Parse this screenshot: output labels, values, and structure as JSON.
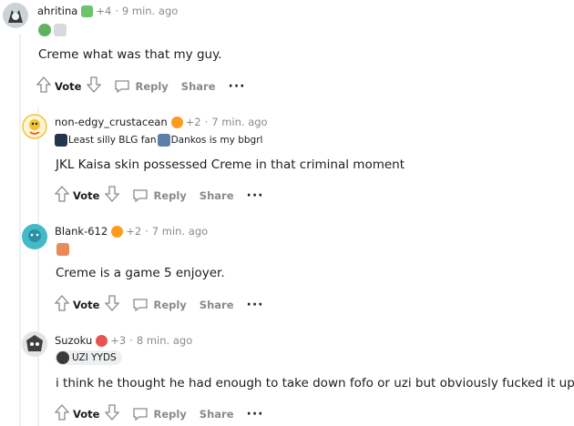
{
  "comments": [
    {
      "author": "ahritina",
      "score": "+4",
      "time": "9 min. ago",
      "body": "Creme what was that my guy.",
      "vote_label": "Vote",
      "reply_label": "Reply",
      "share_label": "Share",
      "more_label": "···"
    },
    {
      "author": "non-edgy_crustacean",
      "score": "+2",
      "time": "7 min. ago",
      "flair_1": "Least silly BLG fan",
      "flair_2": "Dankos is my bbgrl",
      "body": "JKL Kaisa skin possessed Creme in that criminal moment",
      "vote_label": "Vote",
      "reply_label": "Reply",
      "share_label": "Share",
      "more_label": "···"
    },
    {
      "author": "Blank-612",
      "score": "+2",
      "time": "7 min. ago",
      "body": "Creme is a game 5 enjoyer.",
      "vote_label": "Vote",
      "reply_label": "Reply",
      "share_label": "Share",
      "more_label": "···"
    },
    {
      "author": "Suzoku",
      "score": "+3",
      "time": "8 min. ago",
      "flair_1": "UZI YYDS",
      "body": "i think he thought he had enough to take down fofo or uzi but obviously fucked it up",
      "vote_label": "Vote",
      "reply_label": "Reply",
      "share_label": "Share",
      "more_label": "···"
    }
  ],
  "separator": "·",
  "colors": {
    "meta": "#878a8c",
    "thread_line": "#edeff1",
    "award_orange": "#ff9a1f",
    "flair_green": "#46a35a"
  }
}
